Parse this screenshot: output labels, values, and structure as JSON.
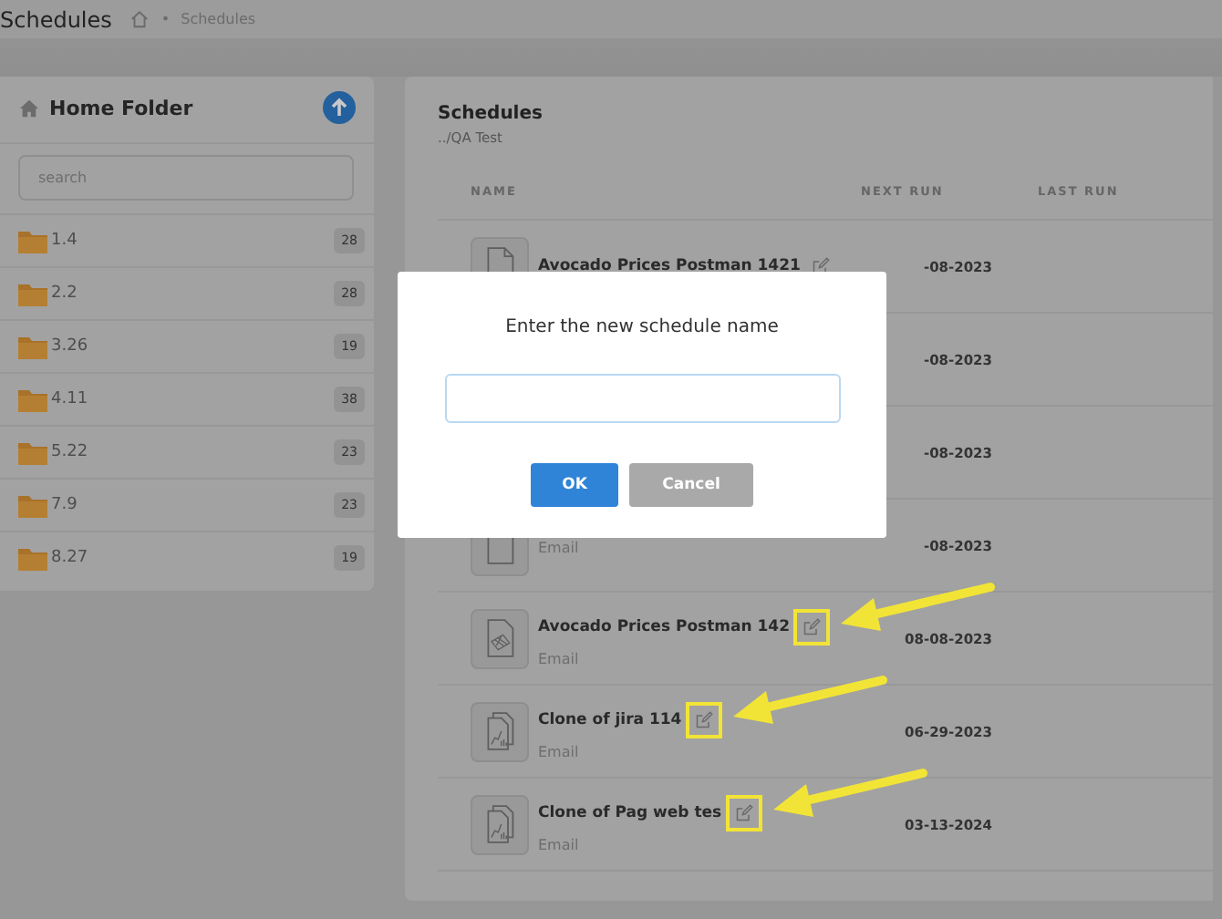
{
  "header": {
    "title": "Schedules",
    "separator": "•",
    "breadcrumb": "Schedules"
  },
  "sidebar": {
    "title": "Home Folder",
    "search": {
      "placeholder": "search"
    },
    "folders": [
      {
        "name": "1.4",
        "count": "28"
      },
      {
        "name": "2.2",
        "count": "28"
      },
      {
        "name": "3.26",
        "count": "19"
      },
      {
        "name": "4.11",
        "count": "38"
      },
      {
        "name": "5.22",
        "count": "23"
      },
      {
        "name": "7.9",
        "count": "23"
      },
      {
        "name": "8.27",
        "count": "19"
      }
    ]
  },
  "main": {
    "title": "Schedules",
    "path": "../QA Test",
    "columns": [
      "NAME",
      "NEXT RUN",
      "LAST RUN"
    ],
    "rows": [
      {
        "kind": "doc",
        "name": "Avocado Prices Postman 1421",
        "edit_icon": true,
        "highlighted": false,
        "next_run": "-08-2023"
      },
      {
        "kind": "hidden",
        "next_run": "-08-2023"
      },
      {
        "kind": "hidden",
        "next_run": "-08-2023"
      },
      {
        "kind": "doc",
        "type": "Email",
        "next_run": "-08-2023"
      },
      {
        "kind": "sheet",
        "name": "Avocado Prices Postman 142",
        "type": "Email",
        "edit_icon": true,
        "highlighted": true,
        "next_run": "08-08-2023"
      },
      {
        "kind": "chart",
        "name": "Clone of jira 114",
        "type": "Email",
        "edit_icon": true,
        "highlighted": true,
        "next_run": "06-29-2023"
      },
      {
        "kind": "chart",
        "name": "Clone of Pag web tes",
        "type": "Email",
        "edit_icon": true,
        "highlighted": true,
        "next_run": "03-13-2024"
      }
    ]
  },
  "dialog": {
    "title": "Enter the new schedule name",
    "buttons": [
      {
        "label": "OK",
        "kind": "primary"
      },
      {
        "label": "Cancel",
        "kind": "secondary"
      }
    ]
  }
}
